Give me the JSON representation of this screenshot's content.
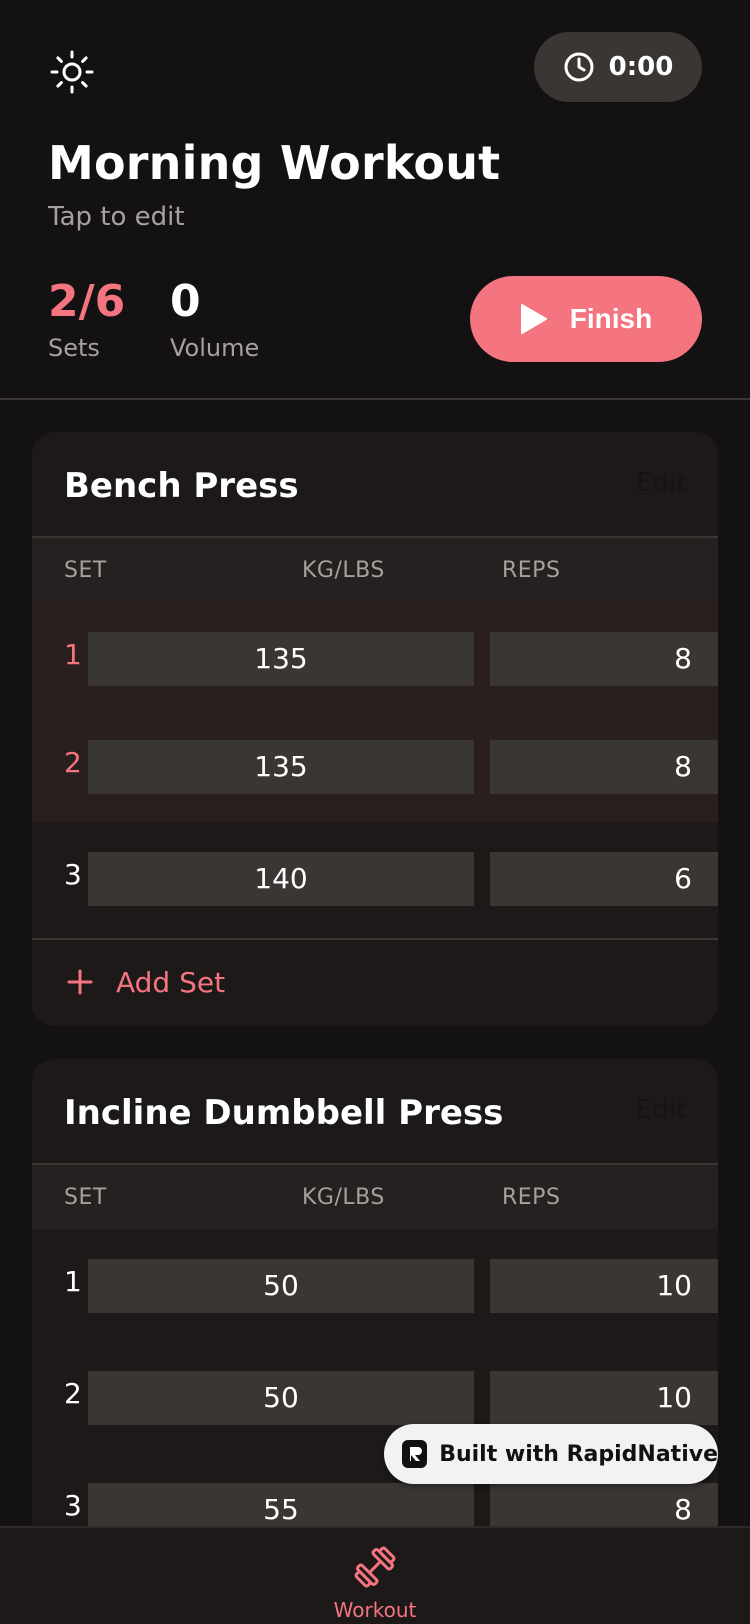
{
  "header": {
    "theme_icon": "sun-icon",
    "timer_icon": "clock-icon",
    "timer_value": "0:00",
    "title": "Morning Workout",
    "subtitle": "Tap to edit",
    "stats": {
      "sets_value": "2/6",
      "sets_label": "Sets",
      "volume_value": "0",
      "volume_label": "Volume"
    },
    "finish_icon": "play-icon",
    "finish_label": "Finish"
  },
  "exercises": [
    {
      "name": "Bench Press",
      "edit_label": "Edit",
      "columns": {
        "set": "SET",
        "weight": "KG/LBS",
        "reps": "REPS"
      },
      "sets": [
        {
          "number": "1",
          "weight": "135",
          "reps": "8",
          "completed": true
        },
        {
          "number": "2",
          "weight": "135",
          "reps": "8",
          "completed": true
        },
        {
          "number": "3",
          "weight": "140",
          "reps": "6",
          "completed": false
        }
      ],
      "add_set_label": "Add Set"
    },
    {
      "name": "Incline Dumbbell Press",
      "edit_label": "Edit",
      "columns": {
        "set": "SET",
        "weight": "KG/LBS",
        "reps": "REPS"
      },
      "sets": [
        {
          "number": "1",
          "weight": "50",
          "reps": "10",
          "completed": false
        },
        {
          "number": "2",
          "weight": "50",
          "reps": "10",
          "completed": false
        },
        {
          "number": "3",
          "weight": "55",
          "reps": "8",
          "completed": false
        }
      ]
    }
  ],
  "badge": {
    "icon": "rapidnative-logo-icon",
    "label": "Built with RapidNative"
  },
  "tab_bar": {
    "tabs": [
      {
        "label": "Workout",
        "icon": "dumbbell-icon",
        "active": true
      }
    ]
  },
  "colors": {
    "accent": "#f47480",
    "background": "#131111",
    "card": "#1c1918",
    "field": "#3a3634",
    "muted_text": "#a6a09e",
    "completed_row": "#2a1f1f"
  }
}
